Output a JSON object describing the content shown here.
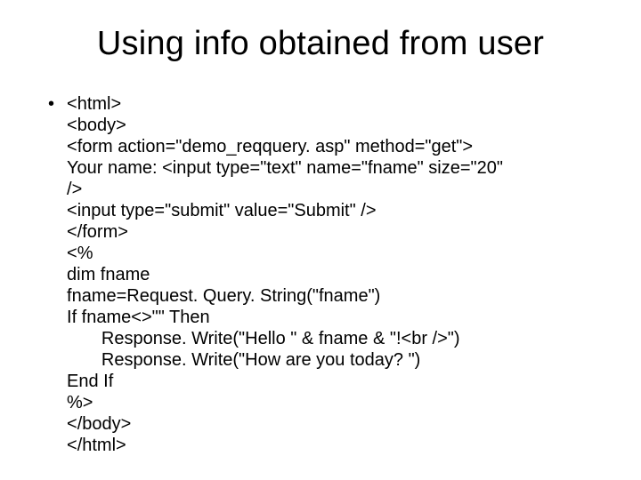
{
  "title": "Using info obtained from user",
  "bullet": "•",
  "code_lines": {
    "l0": "<html>",
    "l1": "<body>",
    "l2": "<form action=\"demo_reqquery. asp\" method=\"get\">",
    "l3": "Your name: <input type=\"text\" name=\"fname\" size=\"20\"",
    "l4": "/>",
    "l5": "<input type=\"submit\" value=\"Submit\" />",
    "l6": "</form>",
    "l7": "<%",
    "l8": "dim fname",
    "l9": "fname=Request. Query. String(\"fname\")",
    "l10": "If fname<>\"\" Then",
    "l11": "       Response. Write(\"Hello \" & fname & \"!<br />\")",
    "l12": "       Response. Write(\"How are you today? \")",
    "l13": "End If",
    "l14": "%>",
    "l15": "</body>",
    "l16": "</html>"
  }
}
